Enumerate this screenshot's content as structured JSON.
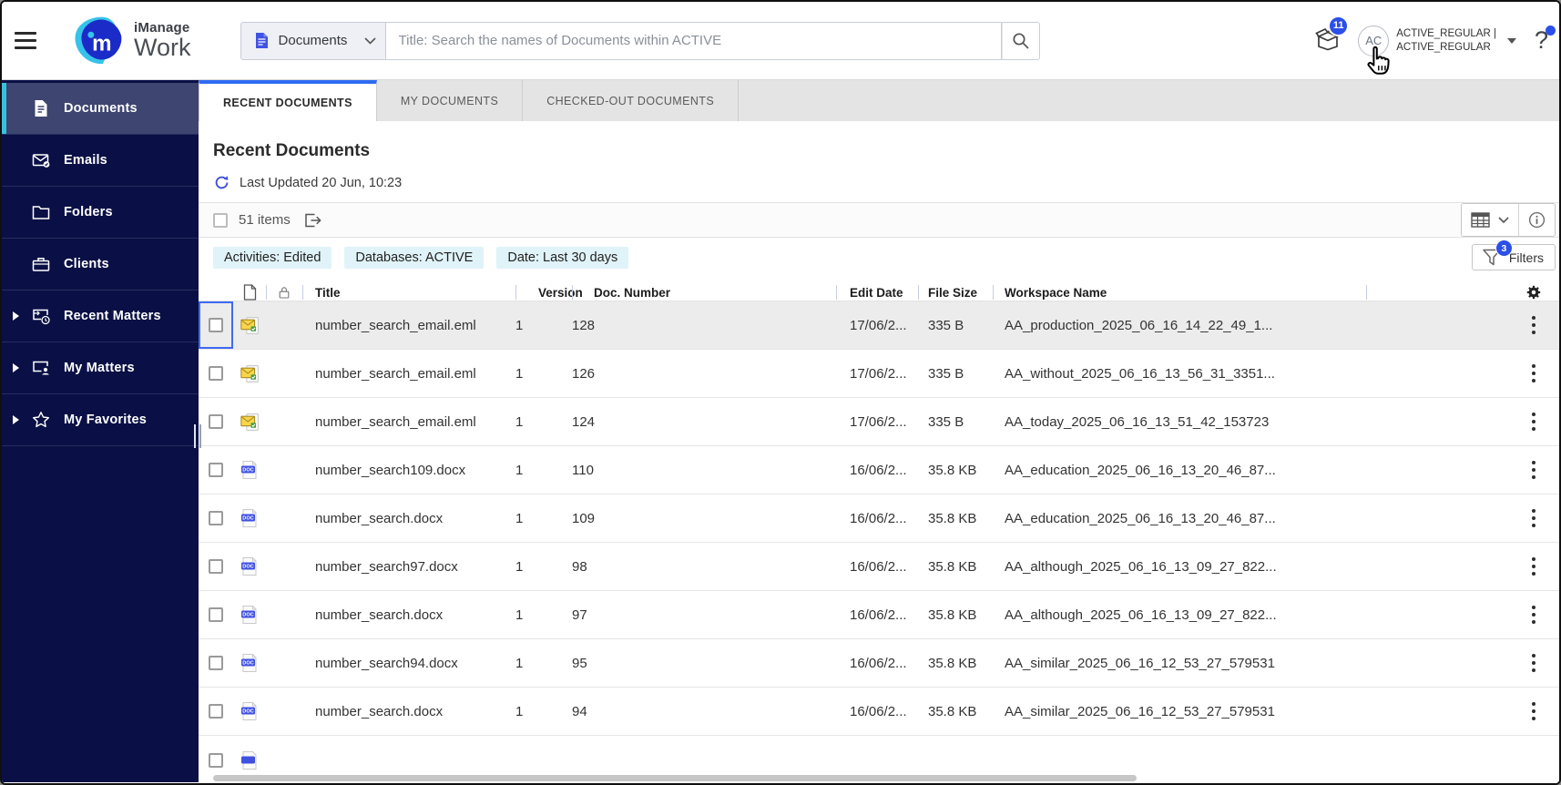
{
  "colors": {
    "accent-blue": "#2c4fe8",
    "sidebar-navy": "#0a1045",
    "sidebar-active": "#3d4570",
    "active-cyan": "#38c1de",
    "tab-active-blue": "#2e6bf2",
    "chip-bg": "#e0f3f8",
    "doc-icon-blue": "#4153e3",
    "refresh-blue": "#3f51d6",
    "selected-row-bg": "#ececec"
  },
  "topbar": {
    "logo_primary": "iManage",
    "logo_secondary": "Work",
    "scope_label": "Documents",
    "search_placeholder": "Title: Search the names of Documents within ACTIVE",
    "notification_count": "11",
    "user_initials": "AC",
    "user_name_line1": "ACTIVE_REGULAR |",
    "user_name_line2": "ACTIVE_REGULAR"
  },
  "sidebar": {
    "items": [
      {
        "label": "Documents",
        "icon": "documents-icon",
        "active": true,
        "expandable": false
      },
      {
        "label": "Emails",
        "icon": "emails-icon",
        "active": false,
        "expandable": false
      },
      {
        "label": "Folders",
        "icon": "folders-icon",
        "active": false,
        "expandable": false
      },
      {
        "label": "Clients",
        "icon": "clients-icon",
        "active": false,
        "expandable": false
      },
      {
        "label": "Recent Matters",
        "icon": "recent-matters-icon",
        "active": false,
        "expandable": true
      },
      {
        "label": "My Matters",
        "icon": "my-matters-icon",
        "active": false,
        "expandable": true
      },
      {
        "label": "My Favorites",
        "icon": "favorites-star-icon",
        "active": false,
        "expandable": true
      }
    ]
  },
  "tabs": [
    {
      "label": "RECENT DOCUMENTS",
      "active": true
    },
    {
      "label": "MY DOCUMENTS",
      "active": false
    },
    {
      "label": "CHECKED-OUT DOCUMENTS",
      "active": false
    }
  ],
  "content": {
    "heading": "Recent Documents",
    "last_updated": "Last Updated 20 Jun, 10:23",
    "items_count": "51 items",
    "filter_chips": [
      "Activities: Edited",
      "Databases: ACTIVE",
      "Date: Last 30 days"
    ],
    "filters_button": {
      "label": "Filters",
      "badge": "3"
    },
    "table": {
      "columns": {
        "title": "Title",
        "version": "Version",
        "doc_number": "Doc. Number",
        "edit_date": "Edit Date",
        "file_size": "File Size",
        "workspace": "Workspace Name"
      },
      "rows": [
        {
          "icon": "email-file-icon",
          "title": "number_search_email.eml",
          "version": "1",
          "doc_number": "128",
          "edit_date": "17/06/2...",
          "file_size": "335 B",
          "workspace": "AA_production_2025_06_16_14_22_49_1...",
          "selected": true
        },
        {
          "icon": "email-file-icon",
          "title": "number_search_email.eml",
          "version": "1",
          "doc_number": "126",
          "edit_date": "17/06/2...",
          "file_size": "335 B",
          "workspace": "AA_without_2025_06_16_13_56_31_3351...",
          "selected": false
        },
        {
          "icon": "email-file-icon",
          "title": "number_search_email.eml",
          "version": "1",
          "doc_number": "124",
          "edit_date": "17/06/2...",
          "file_size": "335 B",
          "workspace": "AA_today_2025_06_16_13_51_42_153723",
          "selected": false
        },
        {
          "icon": "doc-file-icon",
          "title": "number_search109.docx",
          "version": "1",
          "doc_number": "110",
          "edit_date": "16/06/2...",
          "file_size": "35.8 KB",
          "workspace": "AA_education_2025_06_16_13_20_46_87...",
          "selected": false
        },
        {
          "icon": "doc-file-icon",
          "title": "number_search.docx",
          "version": "1",
          "doc_number": "109",
          "edit_date": "16/06/2...",
          "file_size": "35.8 KB",
          "workspace": "AA_education_2025_06_16_13_20_46_87...",
          "selected": false
        },
        {
          "icon": "doc-file-icon",
          "title": "number_search97.docx",
          "version": "1",
          "doc_number": "98",
          "edit_date": "16/06/2...",
          "file_size": "35.8 KB",
          "workspace": "AA_although_2025_06_16_13_09_27_822...",
          "selected": false
        },
        {
          "icon": "doc-file-icon",
          "title": "number_search.docx",
          "version": "1",
          "doc_number": "97",
          "edit_date": "16/06/2...",
          "file_size": "35.8 KB",
          "workspace": "AA_although_2025_06_16_13_09_27_822...",
          "selected": false
        },
        {
          "icon": "doc-file-icon",
          "title": "number_search94.docx",
          "version": "1",
          "doc_number": "95",
          "edit_date": "16/06/2...",
          "file_size": "35.8 KB",
          "workspace": "AA_similar_2025_06_16_12_53_27_579531",
          "selected": false
        },
        {
          "icon": "doc-file-icon",
          "title": "number_search.docx",
          "version": "1",
          "doc_number": "94",
          "edit_date": "16/06/2...",
          "file_size": "35.8 KB",
          "workspace": "AA_similar_2025_06_16_12_53_27_579531",
          "selected": false
        }
      ]
    }
  }
}
